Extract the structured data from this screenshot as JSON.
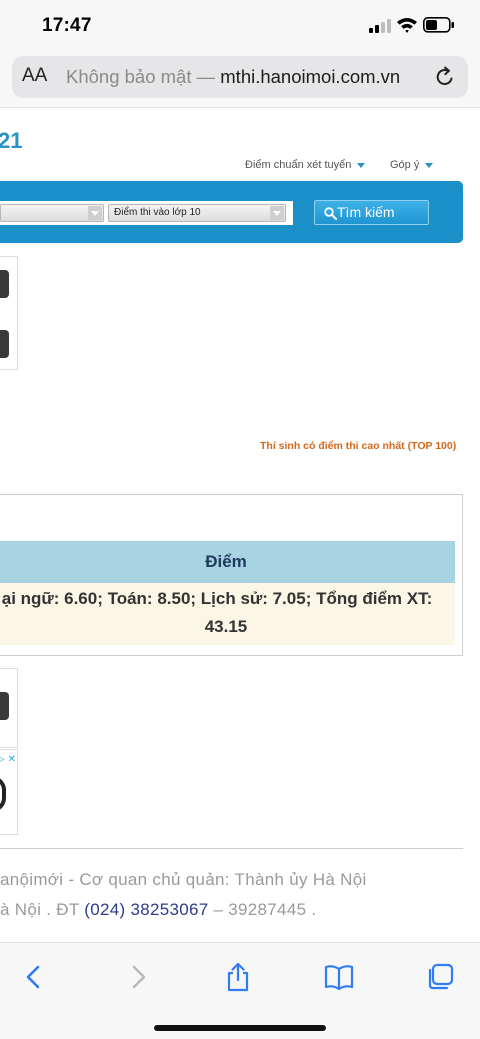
{
  "status_bar": {
    "time": "17:47"
  },
  "browser": {
    "aa_label": "AA",
    "insecure_label": "Không bảo mật —",
    "host": "mthi.hanoimoi.com.vn"
  },
  "page": {
    "site_year": "21",
    "nav": {
      "cutoff_label": "Điểm chuẩn xét tuyển",
      "feedback_label": "Góp ý"
    },
    "search": {
      "exam_select_value": "Điểm thi vào lớp 10",
      "button_label": "Tìm kiếm"
    },
    "top100_link": "Thí sinh có điểm thi cao nhất (TOP 100)",
    "result": {
      "column_header": "Điểm",
      "score_line_1": "ại ngữ: 6.60; Toán: 8.50; Lịch sử: 7.05; Tổng điểm XT:",
      "score_line_2": "43.15"
    },
    "ad": {
      "icons": "▷ ✕"
    },
    "footer": {
      "line_1": "anộimới - Cơ quan chủ quản: Thành ủy Hà Nội",
      "line_2_prefix": "à Nội . ĐT ",
      "phone": "(024) 38253067",
      "line_2_suffix": " – 39287445 ."
    }
  },
  "colors": {
    "brand_blue": "#1a8fc8",
    "table_header": "#a7d3e3",
    "row_background": "#fbf6e5",
    "top100_link": "#d2691e",
    "ios_blue": "#2f7cf6"
  },
  "toolbar": {
    "icons": [
      "back-arrow-icon",
      "forward-arrow-icon",
      "share-icon",
      "bookmarks-icon",
      "tabs-icon"
    ]
  }
}
